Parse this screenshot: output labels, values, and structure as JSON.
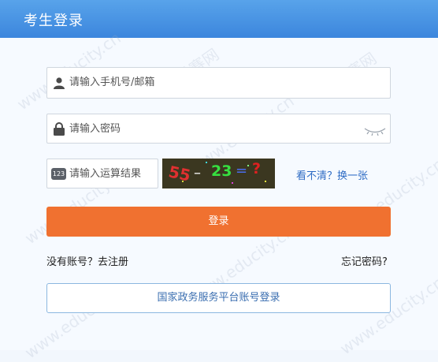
{
  "header": {
    "title": "考生登录"
  },
  "form": {
    "phone_placeholder": "请输入手机号/邮箱",
    "password_placeholder": "请输入密码",
    "captcha_placeholder": "请输入运算结果",
    "captcha_badge": "123",
    "captcha_image": {
      "left": "55",
      "op": "–",
      "right": "23",
      "eq": "=",
      "q": "?"
    },
    "refresh_captcha": "看不清？换一张",
    "login_button": "登录"
  },
  "links": {
    "register": "没有账号？去注册",
    "forgot": "忘记密码?"
  },
  "gov_login": "国家政务服务平台账号登录",
  "watermark": {
    "text": "希赛网",
    "url": "www.educity.cn"
  },
  "colors": {
    "header": "#3c86dd",
    "accent": "#f07130",
    "link": "#2d6bc4"
  }
}
